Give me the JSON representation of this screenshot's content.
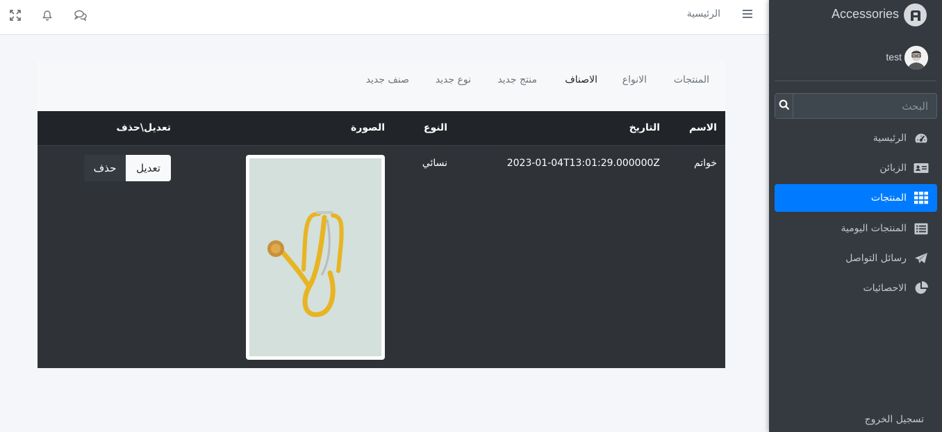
{
  "brand": {
    "name": "Accessories"
  },
  "user": {
    "name": "test"
  },
  "search": {
    "placeholder": "البحث"
  },
  "navbar": {
    "home_label": "الرئيسية"
  },
  "sidebar": {
    "items": [
      {
        "label": "الرئيسية",
        "icon": "dashboard-gauge-icon",
        "active": false
      },
      {
        "label": "الزبائن",
        "icon": "id-card-icon",
        "active": false
      },
      {
        "label": "المنتجات",
        "icon": "grid-table-icon",
        "active": true
      },
      {
        "label": "المنتجات اليومية",
        "icon": "list-alt-icon",
        "active": false
      },
      {
        "label": "رسائل التواصل",
        "icon": "paper-plane-icon",
        "active": false
      },
      {
        "label": "الاحصائيات",
        "icon": "pie-chart-icon",
        "active": false
      }
    ],
    "logout_label": "تسجيل الخروج"
  },
  "tabs": [
    {
      "label": "المنتجات",
      "active": false
    },
    {
      "label": "الانواع",
      "active": false
    },
    {
      "label": "الاصناف",
      "active": true
    },
    {
      "label": "منتج جديد",
      "active": false
    },
    {
      "label": "نوع جديد",
      "active": false
    },
    {
      "label": "صنف جديد",
      "active": false
    }
  ],
  "table": {
    "headers": [
      "الاسم",
      "التاريخ",
      "النوع",
      "الصورة",
      "تعديل\\حذف"
    ],
    "rows": [
      {
        "name": "خواتم",
        "date": "2023-01-04T13:01:29.000000Z",
        "type": "نسائي",
        "image": "stethoscope-photo",
        "edit_label": "تعديل",
        "delete_label": "حذف"
      }
    ]
  },
  "colors": {
    "accent": "#007bff",
    "sidebar": "#343a40",
    "table_dark": "#212529"
  }
}
